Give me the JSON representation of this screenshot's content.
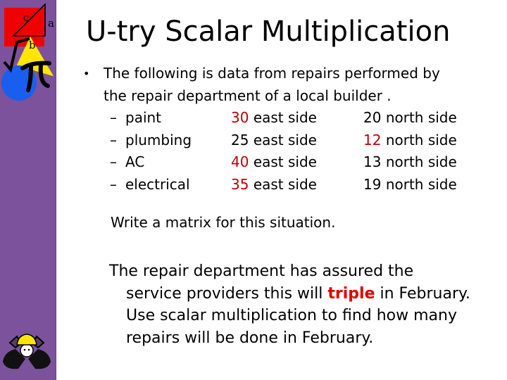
{
  "slide": {
    "title": "U-try Scalar Multiplication",
    "bullet": {
      "line1": "The following is data from repairs performed by",
      "line2": "the repair department of a local builder ."
    },
    "rows": [
      {
        "dash": "–",
        "label": "paint",
        "east_value": "30",
        "east_value_red": true,
        "east_text": "east side",
        "north_value": "20",
        "north_value_red": false,
        "north_text": "north side"
      },
      {
        "dash": "–",
        "label": "plumbing",
        "east_value": "25",
        "east_value_red": false,
        "east_text": "east side",
        "north_value": "12",
        "north_value_red": true,
        "north_text": "north side"
      },
      {
        "dash": "–",
        "label": "AC",
        "east_value": "40",
        "east_value_red": true,
        "east_text": "east side",
        "north_value": "13",
        "north_value_red": false,
        "north_text": "north side"
      },
      {
        "dash": "–",
        "label": "electrical",
        "east_value": "35",
        "east_value_red": true,
        "east_text": "east side",
        "north_value": "19",
        "north_value_red": false,
        "north_text": "north side"
      }
    ],
    "instruction": "Write a matrix for this situation.",
    "paragraph": {
      "first_line": "The repair department has assured the",
      "pre_highlight": "service providers this will ",
      "highlight": "triple",
      "post_highlight": " in February. Use scalar multiplication to find how many repairs will be done in February."
    }
  },
  "sidebar": {
    "logo_labels": {
      "c": "c",
      "a": "a",
      "b": "b"
    },
    "icons": [
      "geometry-logo-icon",
      "construction-worker-icon"
    ]
  },
  "colors": {
    "sidebar": "#7c529c",
    "red_number": "#c00000",
    "highlight": "#e00000"
  }
}
